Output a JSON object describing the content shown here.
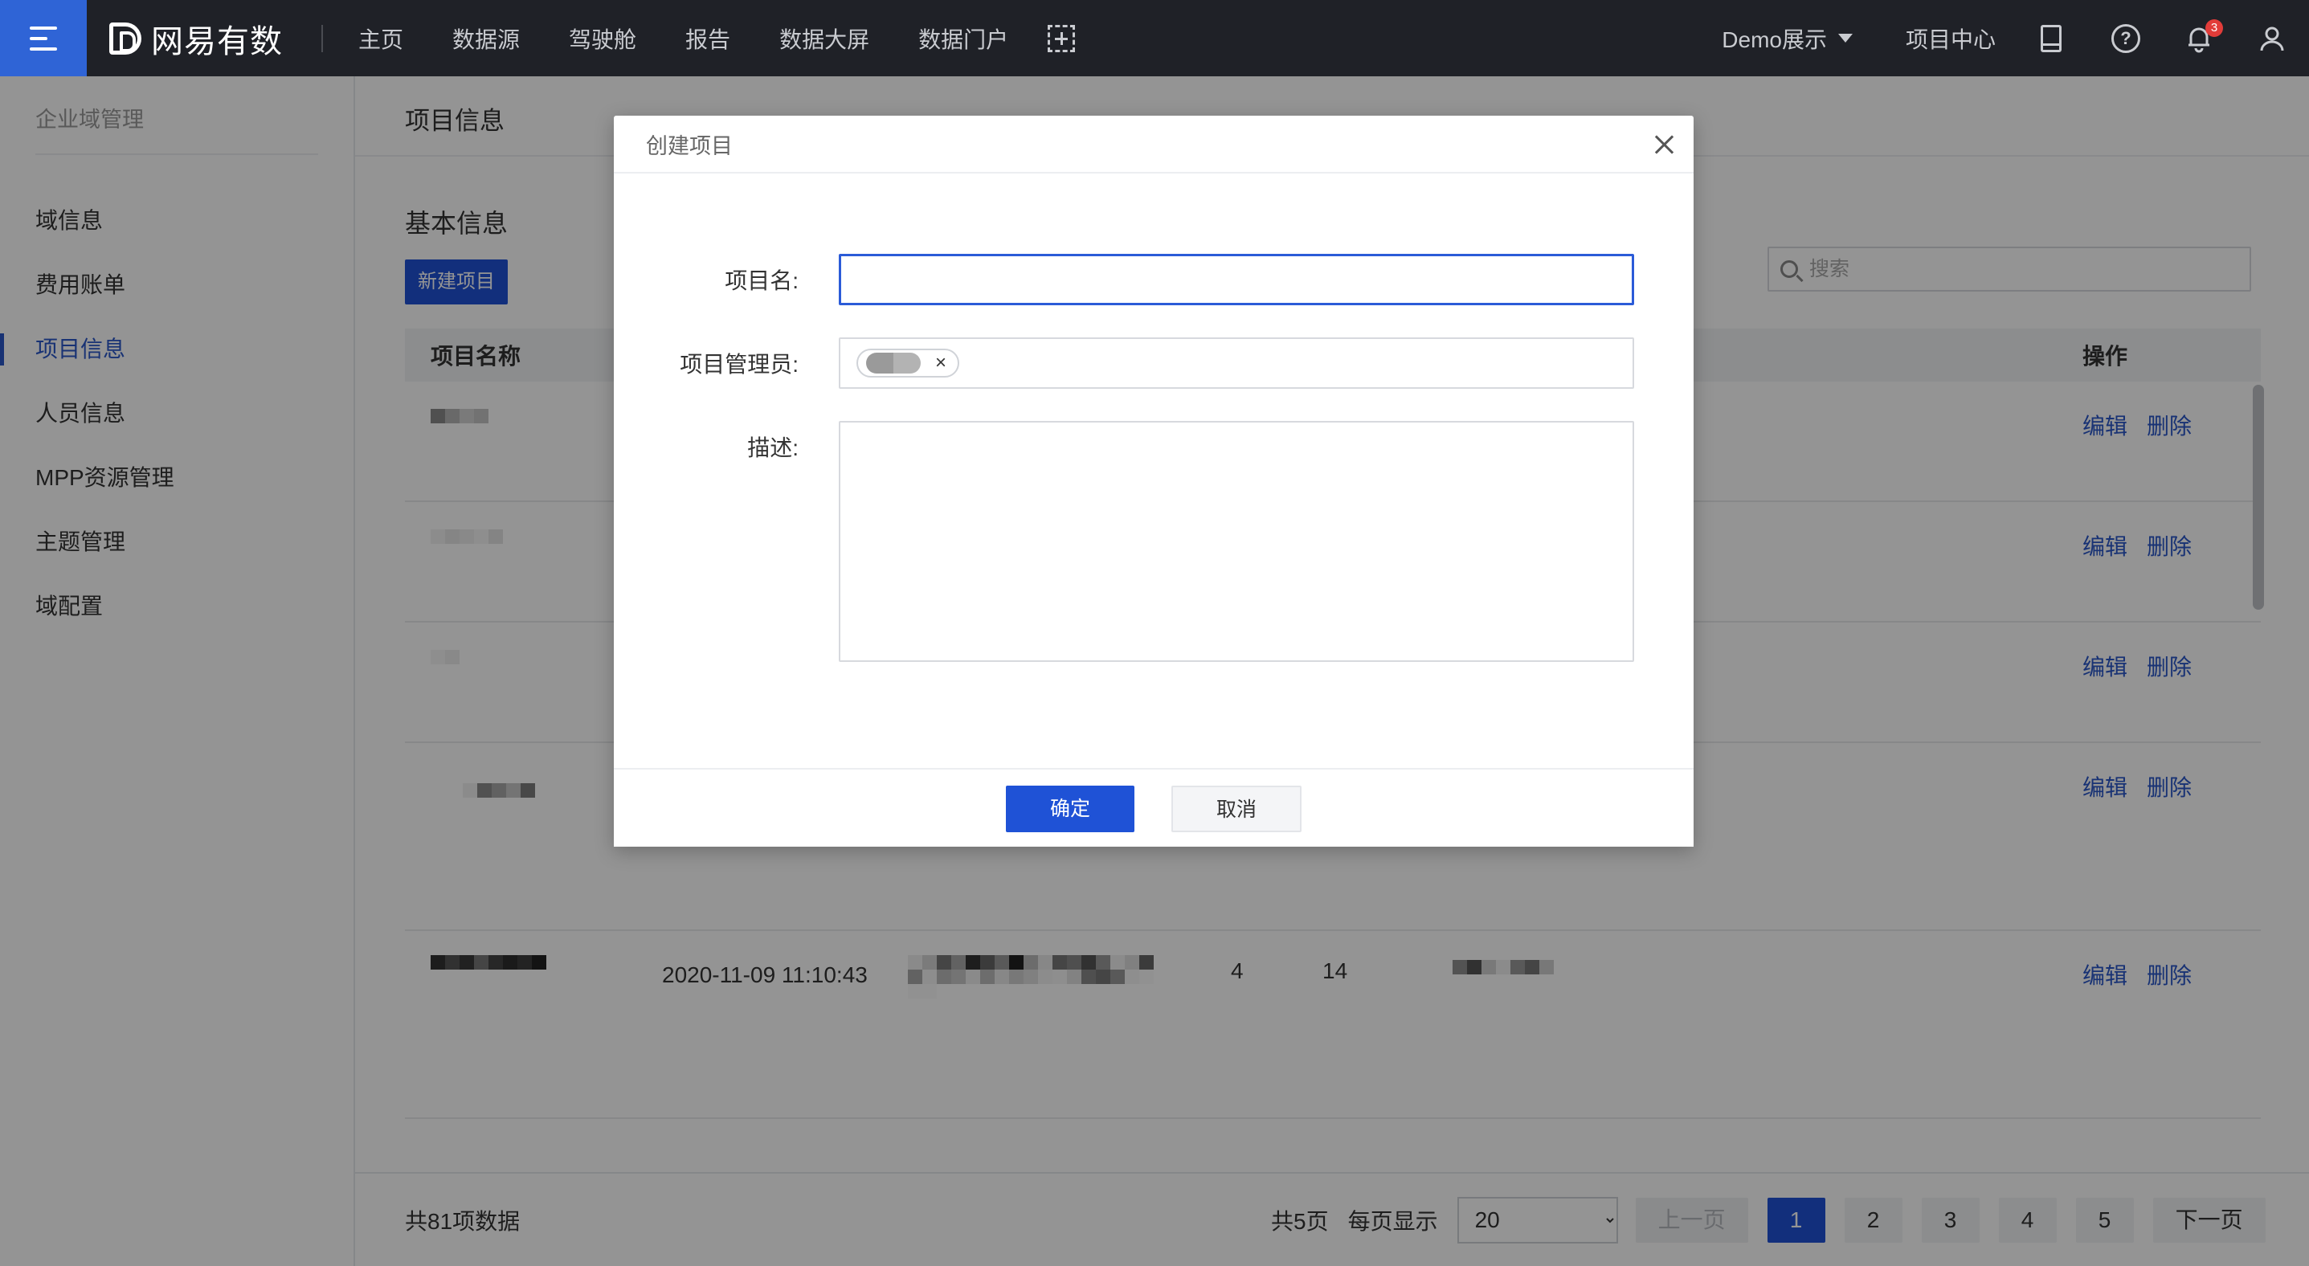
{
  "topbar": {
    "brand": "网易有数",
    "nav": [
      "主页",
      "数据源",
      "驾驶舱",
      "报告",
      "数据大屏",
      "数据门户"
    ],
    "demo_label": "Demo展示",
    "project_center": "项目中心",
    "notification_count": "3",
    "help_glyph": "?"
  },
  "sidebar": {
    "title": "企业域管理",
    "items": [
      {
        "label": "域信息",
        "active": false
      },
      {
        "label": "费用账单",
        "active": false
      },
      {
        "label": "项目信息",
        "active": true
      },
      {
        "label": "人员信息",
        "active": false
      },
      {
        "label": "MPP资源管理",
        "active": false
      },
      {
        "label": "主题管理",
        "active": false
      },
      {
        "label": "域配置",
        "active": false
      }
    ]
  },
  "main": {
    "page_title": "项目信息",
    "section_title": "基本信息",
    "new_button": "新建项目",
    "search_placeholder": "搜索",
    "table": {
      "col_name": "项目名称",
      "col_actions": "操作",
      "edit": "编辑",
      "delete": "删除",
      "visible_row": {
        "created": "2020-11-09 11:10:43",
        "col_a": "4",
        "col_b": "14"
      }
    },
    "footer": {
      "total": "共81项数据",
      "pages_total": "共5页",
      "per_page_label": "每页显示",
      "per_page_value": "20",
      "prev": "上一页",
      "next": "下一页",
      "pages": [
        "1",
        "2",
        "3",
        "4",
        "5"
      ],
      "current_page": "1"
    }
  },
  "modal": {
    "title": "创建项目",
    "name_label": "项目名:",
    "name_value": "",
    "admin_label": "项目管理员:",
    "admin_tag_remove": "×",
    "desc_label": "描述:",
    "desc_value": "",
    "ok": "确定",
    "cancel": "取消"
  },
  "colors": {
    "accent": "#1f52d6",
    "link": "#2a57c9",
    "topbar": "#1f2127",
    "badge": "#e23c39"
  }
}
